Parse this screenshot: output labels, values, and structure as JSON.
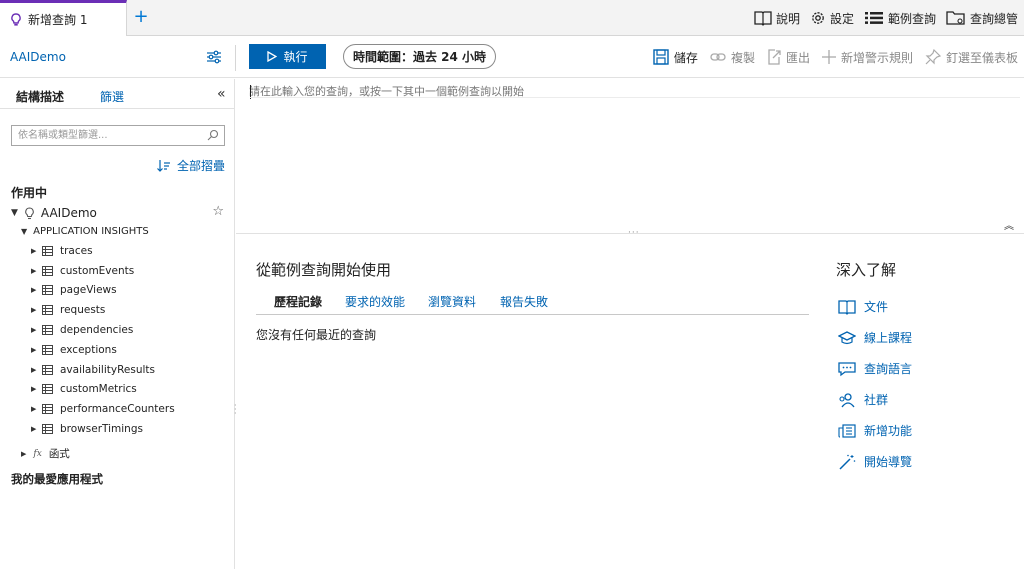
{
  "tab": {
    "label": "新增查詢 1",
    "add_label": "+"
  },
  "topbar": [
    {
      "label": "說明",
      "icon": "book-icon"
    },
    {
      "label": "設定",
      "icon": "gear-icon"
    },
    {
      "label": "範例查詢",
      "icon": "list-icon"
    },
    {
      "label": "查詢總管",
      "icon": "folder-icon"
    }
  ],
  "toolbar": {
    "app_name": "AAIDemo",
    "run_label": "執行",
    "time_range": "時間範圍：過去 24 小時",
    "actions": [
      {
        "label": "儲存",
        "icon": "save-icon",
        "enabled": true
      },
      {
        "label": "複製",
        "icon": "link-icon",
        "enabled": false
      },
      {
        "label": "匯出",
        "icon": "export-icon",
        "enabled": false
      },
      {
        "label": "新增警示規則",
        "icon": "plus-icon",
        "enabled": false
      },
      {
        "label": "釘選至儀表板",
        "icon": "pin-icon",
        "enabled": false
      }
    ]
  },
  "left_panel": {
    "tab_schema": "結構描述",
    "tab_filter": "篩選",
    "collapse_glyph": "«",
    "search_placeholder": "依名稱或類型篩選...",
    "collapse_all": "全部摺疊",
    "active_section": "作用中",
    "app_name": "AAIDemo",
    "ai_group": "APPLICATION INSIGHTS",
    "tables": [
      "traces",
      "customEvents",
      "pageViews",
      "requests",
      "dependencies",
      "exceptions",
      "availabilityResults",
      "customMetrics",
      "performanceCounters",
      "browserTimings"
    ],
    "functions_label": "函式",
    "favorites_section": "我的最愛應用程式"
  },
  "editor": {
    "placeholder": "請在此輸入您的查詢，或按一下其中一個範例查詢以開始"
  },
  "results": {
    "title": "從範例查詢開始使用",
    "tabs": [
      "歷程記錄",
      "要求的效能",
      "瀏覽資料",
      "報告失敗"
    ],
    "empty_text": "您沒有任何最近的查詢"
  },
  "learn": {
    "title": "深入了解",
    "items": [
      {
        "label": "文件",
        "icon": "doc-icon"
      },
      {
        "label": "線上課程",
        "icon": "course-icon"
      },
      {
        "label": "查詢語言",
        "icon": "chat-icon"
      },
      {
        "label": "社群",
        "icon": "community-icon"
      },
      {
        "label": "新增功能",
        "icon": "news-icon"
      },
      {
        "label": "開始導覽",
        "icon": "wand-icon"
      }
    ]
  },
  "colors": {
    "accent": "#0063b1",
    "tab_top": "#6b2fb6"
  }
}
